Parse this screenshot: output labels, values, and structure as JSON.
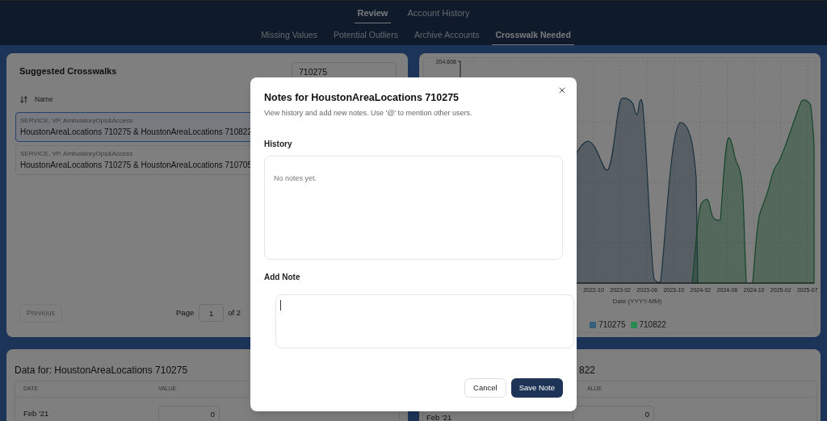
{
  "nav": {
    "tabs": [
      {
        "label": "Review",
        "selected": true
      },
      {
        "label": "Account History",
        "selected": false
      }
    ],
    "subtabs": [
      {
        "label": "Missing Values",
        "selected": false
      },
      {
        "label": "Potential Outliers",
        "selected": false
      },
      {
        "label": "Archive Accounts",
        "selected": false
      },
      {
        "label": "Crosswalk Needed",
        "selected": true
      }
    ]
  },
  "crosswalks": {
    "title": "Suggested Crosswalks",
    "search": {
      "value": "710275"
    },
    "sort_label": "Name",
    "items": [
      {
        "category": "SERVICE, VP, AmbulatoryOps&Access",
        "name": "HoustonAreaLocations 710275 & HoustonAreaLocations 710822",
        "selected": true
      },
      {
        "category": "SERVICE, VP, AmbulatoryOps&Access",
        "name": "HoustonAreaLocations 710275 & HoustonAreaLocations 710705",
        "selected": false
      }
    ],
    "pagination": {
      "previous": "Previous",
      "previous_disabled": true,
      "page_label": "Page",
      "page": "1",
      "of": "of 2"
    }
  },
  "chart": {
    "y_tick": "204,608",
    "x_ticks": [
      "2022-10",
      "2023-02",
      "2023-06",
      "2023-10",
      "2024-02",
      "2024-06",
      "2024-10",
      "2025-02",
      "2025-07"
    ],
    "x_axis_title": "Date (YYYY-MM)",
    "legend": [
      {
        "label": "710275",
        "color": "#34607c"
      },
      {
        "label": "710822",
        "color": "#2a8a50"
      }
    ]
  },
  "data_left": {
    "title": "Data for: HoustonAreaLocations 710275",
    "columns": [
      "DATE",
      "VALUE"
    ],
    "rows": [
      {
        "date": "Feb '21",
        "value": "0"
      }
    ]
  },
  "data_right": {
    "title": "822",
    "columns": [
      "ALUE"
    ],
    "rows": [
      {
        "date": "Feb '21",
        "value": "0"
      }
    ]
  },
  "modal": {
    "title": "Notes for HoustonAreaLocations 710275",
    "description": "View history and add new notes. Use '@' to mention other users.",
    "history_label": "History",
    "history_empty": "No notes yet.",
    "add_label": "Add Note",
    "buttons": [
      {
        "label": "Cancel",
        "kind": "secondary"
      },
      {
        "label": "Save Note",
        "kind": "primary"
      }
    ]
  }
}
